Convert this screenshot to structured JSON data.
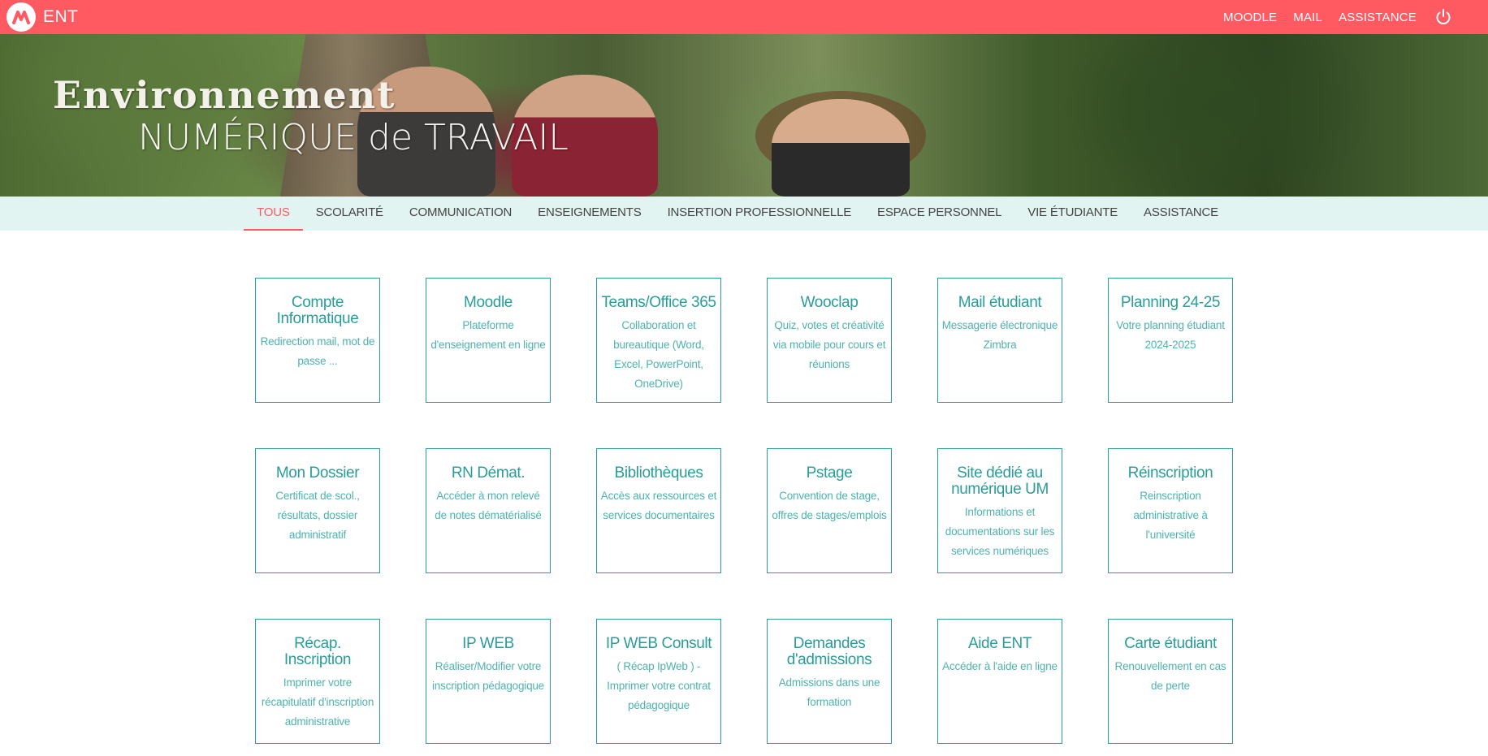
{
  "header": {
    "app_name": "ENT",
    "links": [
      "MOODLE",
      "MAIL",
      "ASSISTANCE"
    ],
    "logo_icon": "um-logo-icon",
    "power_icon": "power-icon",
    "accent_color": "#ff5a62"
  },
  "banner": {
    "title": "Environnement",
    "subtitle": "NUMÉRIQUE de TRAVAIL"
  },
  "nav": {
    "tabs": [
      "TOUS",
      "SCOLARITÉ",
      "COMMUNICATION",
      "ENSEIGNEMENTS",
      "INSERTION PROFESSIONNELLE",
      "ESPACE PERSONNEL",
      "VIE ÉTUDIANTE",
      "ASSISTANCE"
    ],
    "active": "TOUS",
    "background_color": "#e2f4f2"
  },
  "tiles": [
    {
      "title": "Compte Informatique",
      "desc": "Redirection mail, mot de passe ..."
    },
    {
      "title": "Moodle",
      "desc": "Plateforme d'enseignement en ligne"
    },
    {
      "title": "Teams/Office 365",
      "desc": "Collaboration et bureautique (Word, Excel, PowerPoint, OneDrive)"
    },
    {
      "title": "Wooclap",
      "desc": "Quiz, votes et créativité via mobile pour cours et réunions"
    },
    {
      "title": "Mail étudiant",
      "desc": "Messagerie électronique Zimbra"
    },
    {
      "title": "Planning 24-25",
      "desc": "Votre planning étudiant 2024-2025"
    },
    {
      "title": "Mon Dossier",
      "desc": "Certificat de scol., résultats, dossier administratif"
    },
    {
      "title": "RN Démat.",
      "desc": "Accéder à mon relevé de notes dématérialisé"
    },
    {
      "title": "Bibliothèques",
      "desc": "Accès aux ressources et services documentaires"
    },
    {
      "title": "Pstage",
      "desc": "Convention de stage, offres de stages/emplois"
    },
    {
      "title": "Site dédié au numérique UM",
      "desc": "Informations et documentations sur les services numériques"
    },
    {
      "title": "Réinscription",
      "desc": "Reinscription administrative à l'université"
    },
    {
      "title": "Récap. Inscription",
      "desc": "Imprimer votre récapitulatif d'inscription administrative"
    },
    {
      "title": "IP WEB",
      "desc": "Réaliser/Modifier votre inscription pédagogique"
    },
    {
      "title": "IP WEB Consult",
      "desc": "( Récap IpWeb ) - Imprimer votre contrat pédagogique"
    },
    {
      "title": "Demandes d'admissions",
      "desc": "Admissions dans une formation"
    },
    {
      "title": "Aide ENT",
      "desc": "Accéder à l'aide en ligne"
    },
    {
      "title": "Carte étudiant",
      "desc": "Renouvellement en cas de perte"
    }
  ],
  "tile_color": "#2b9c98"
}
